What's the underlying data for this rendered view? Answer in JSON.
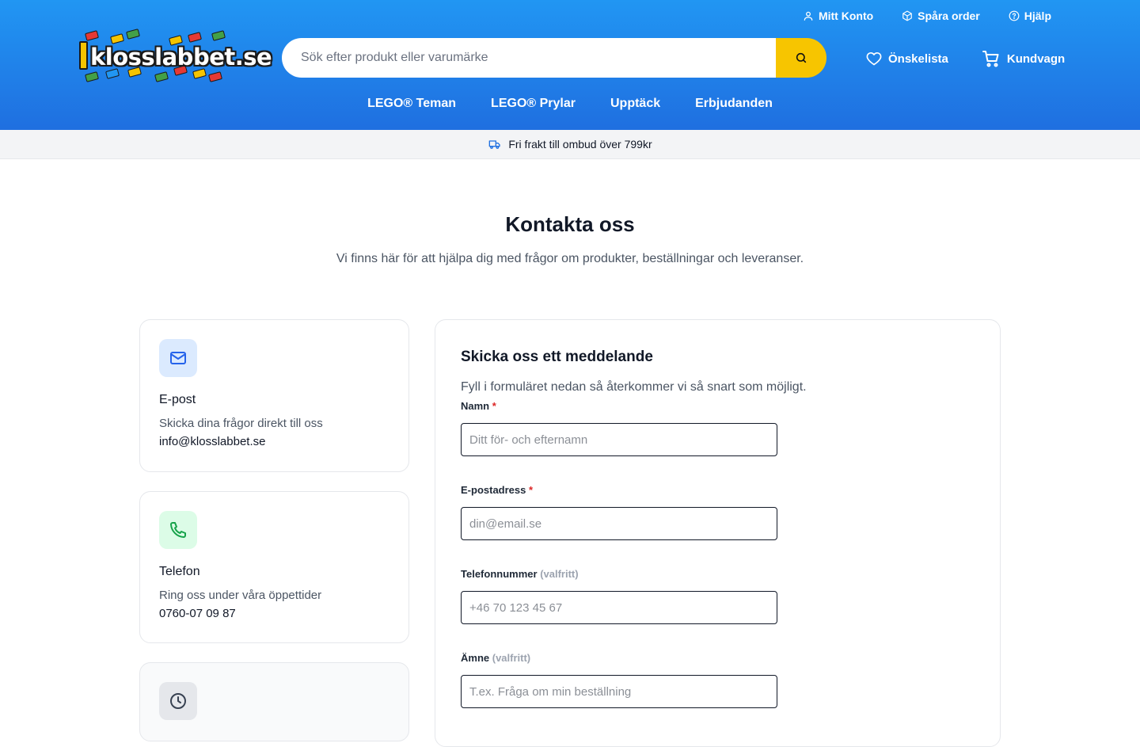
{
  "header": {
    "logo_text": "klosslabbet.se",
    "top_links": [
      "Mitt Konto",
      "Spåra order",
      "Hjälp"
    ],
    "search_placeholder": "Sök efter produkt eller varumärke",
    "wishlist_label": "Önskelista",
    "cart_label": "Kundvagn",
    "nav": [
      "LEGO® Teman",
      "LEGO® Prylar",
      "Upptäck",
      "Erbjudanden"
    ]
  },
  "promo": {
    "text": "Fri frakt till ombud över 799kr"
  },
  "page": {
    "title": "Kontakta oss",
    "subtitle": "Vi finns här för att hjälpa dig med frågor om produkter, beställningar och leveranser."
  },
  "contact": {
    "email": {
      "title": "E-post",
      "desc": "Skicka dina frågor direkt till oss",
      "value": "info@klosslabbet.se"
    },
    "phone": {
      "title": "Telefon",
      "desc": "Ring oss under våra öppettider",
      "value": "0760-07 09 87"
    }
  },
  "form": {
    "title": "Skicka oss ett meddelande",
    "desc": "Fyll i formuläret nedan så återkommer vi så snart som möjligt.",
    "name_label": "Namn",
    "name_placeholder": "Ditt för- och efternamn",
    "email_label": "E-postadress",
    "email_placeholder": "din@email.se",
    "phone_label": "Telefonnummer",
    "phone_placeholder": "+46 70 123 45 67",
    "subject_label": "Ämne",
    "subject_placeholder": "T.ex. Fråga om min beställning",
    "required_marker": "*",
    "optional_marker": "(valfritt)"
  },
  "colors": {
    "header_top": "#2196f3",
    "header_bottom": "#1f6fe0",
    "search_button": "#f7c500",
    "email_icon_bg": "#dbeafe",
    "phone_icon_bg": "#dcfce7",
    "clock_icon_bg": "#e5e7eb"
  },
  "icons": [
    "user-icon",
    "box-icon",
    "help-icon",
    "search-icon",
    "heart-icon",
    "cart-icon",
    "truck-icon",
    "mail-icon",
    "phone-icon",
    "clock-icon"
  ]
}
